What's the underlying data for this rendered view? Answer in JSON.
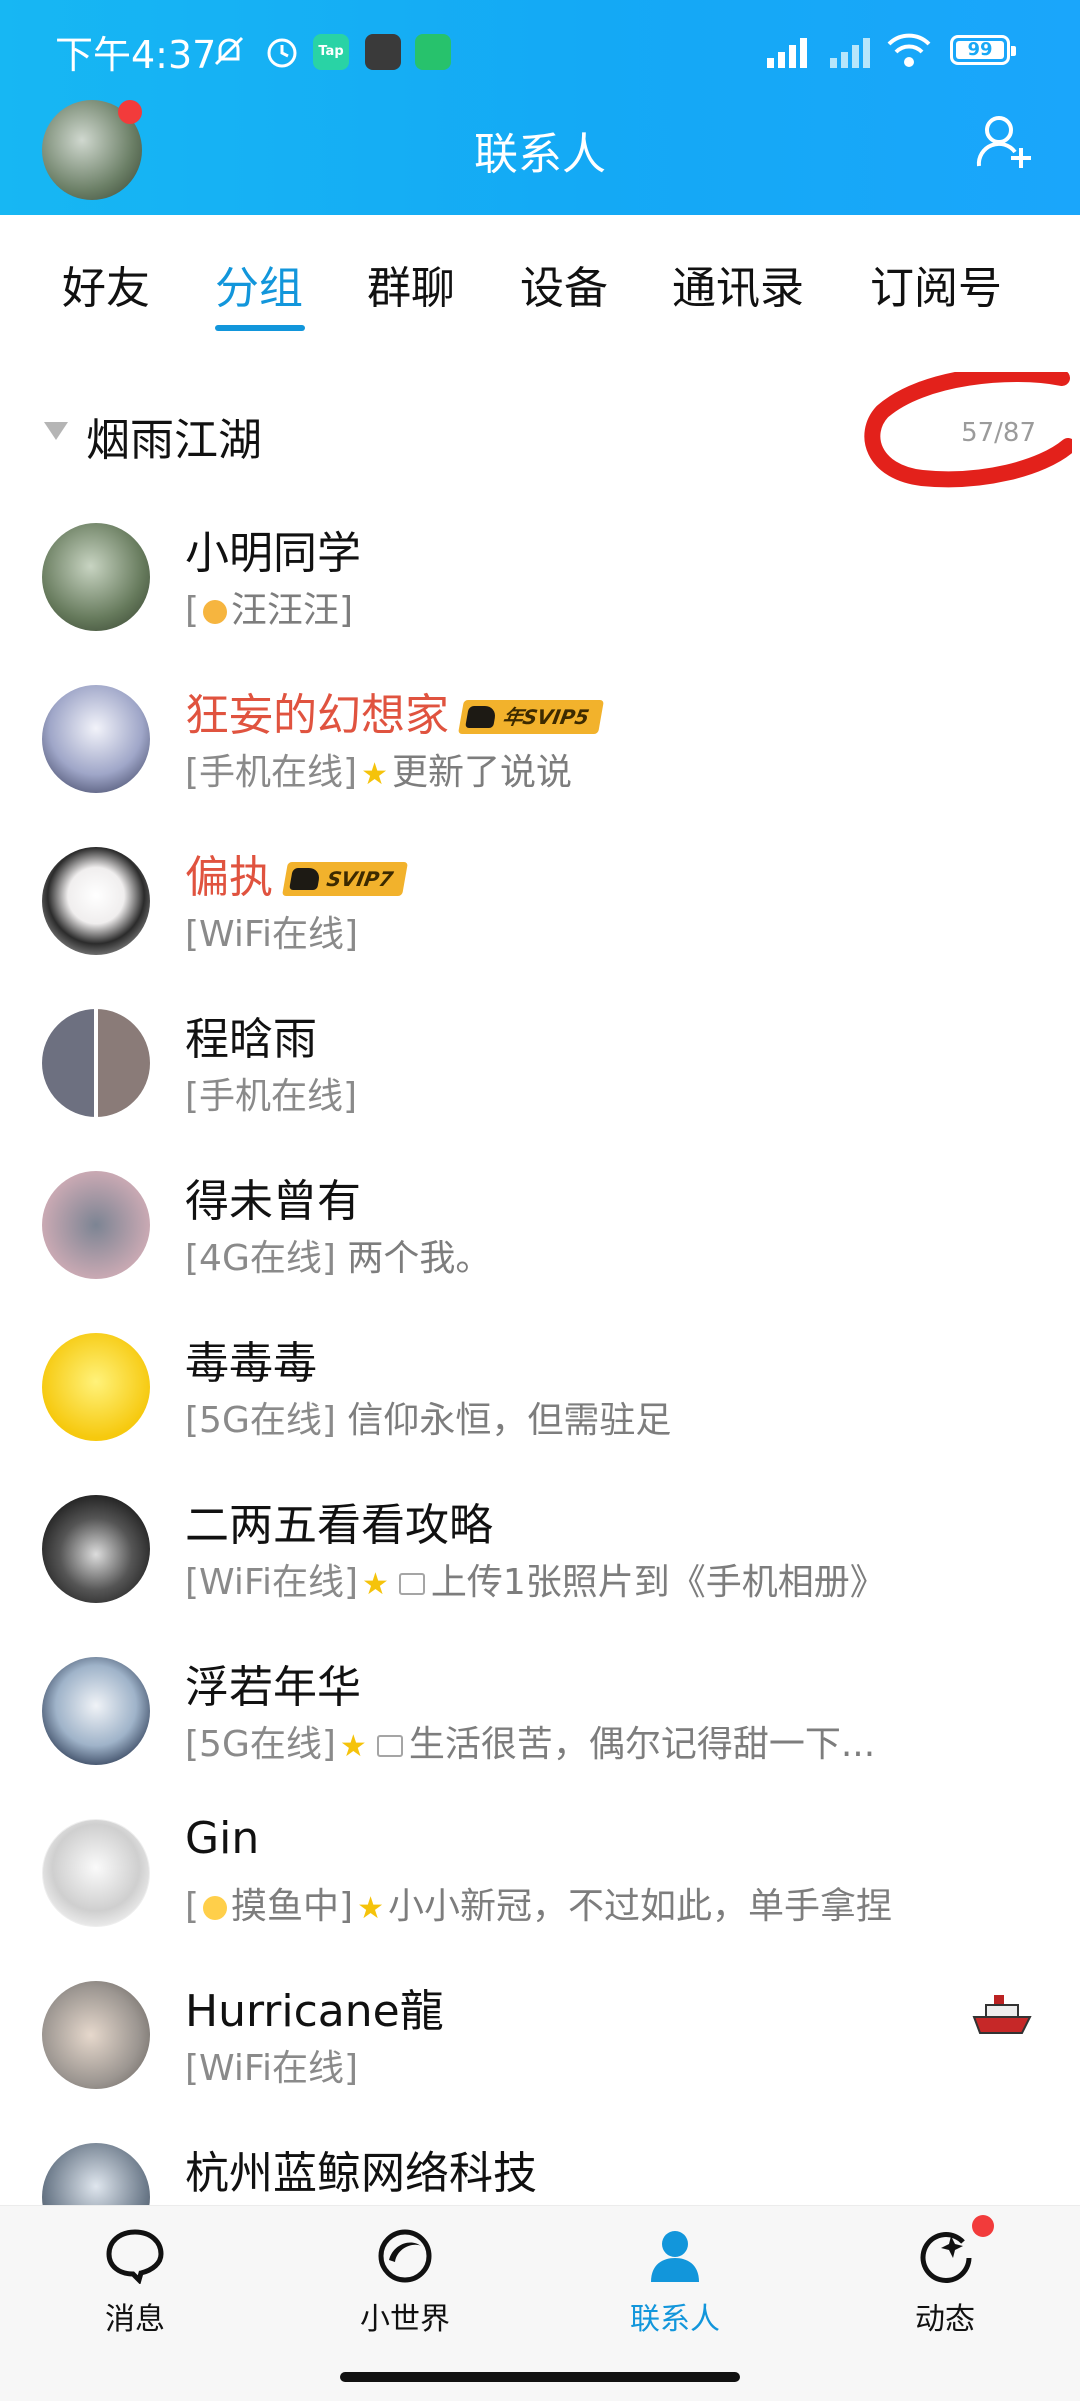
{
  "status_bar": {
    "time": "下午4:37",
    "battery": "99",
    "battery_level": 0.99
  },
  "header": {
    "title": "联系人"
  },
  "tabs": [
    {
      "label": "好友",
      "active": false
    },
    {
      "label": "分组",
      "active": true
    },
    {
      "label": "群聊",
      "active": false
    },
    {
      "label": "设备",
      "active": false
    },
    {
      "label": "通讯录",
      "active": false
    },
    {
      "label": "订阅号",
      "active": false
    }
  ],
  "group": {
    "name": "烟雨江湖",
    "count": "57/87"
  },
  "contacts": [
    {
      "name": "小明同学",
      "status": "[",
      "status_mid": "汪汪汪]",
      "status_text": ""
    },
    {
      "name": "狂妄的幻想家",
      "badge": "年SVIP5",
      "status": "[手机在线]",
      "status_text": "更新了说说"
    },
    {
      "name": "偏执",
      "badge": "SVIP7",
      "status": "[WiFi在线]",
      "status_text": ""
    },
    {
      "name": "程晗雨",
      "status": "[手机在线]",
      "status_text": ""
    },
    {
      "name": "得未曾有",
      "status": "[4G在线]",
      "status_text": "两个我。"
    },
    {
      "name": "毒毒毒",
      "status": "[5G在线]",
      "status_text": "信仰永恒，但需驻足"
    },
    {
      "name": "二两五看看攻略",
      "status": "[WiFi在线]",
      "status_text": "上传1张照片到《手机相册》"
    },
    {
      "name": "浮若年华",
      "status": "[5G在线]",
      "status_text": "生活很苦，偶尔记得甜一下..."
    },
    {
      "name": "Gin",
      "status": "[",
      "status_mid": "摸鱼中]",
      "status_text": "小小新冠，不过如此，单手拿捏"
    },
    {
      "name": "Hurricane龍",
      "status": "[WiFi在线]",
      "status_text": ""
    },
    {
      "name": "杭州蓝鲸网络科技",
      "status": "",
      "status_text": ""
    }
  ],
  "bottom_nav": [
    {
      "label": "消息",
      "icon": "message-bubble-icon"
    },
    {
      "label": "小世界",
      "icon": "small-world-icon"
    },
    {
      "label": "联系人",
      "icon": "contacts-person-icon",
      "active": true
    },
    {
      "label": "动态",
      "icon": "moments-star-icon"
    }
  ],
  "colors": {
    "header": "#17b7f3",
    "accent": "#1296db",
    "vip_name": "#e0533f",
    "badge": "#f2b22c"
  }
}
